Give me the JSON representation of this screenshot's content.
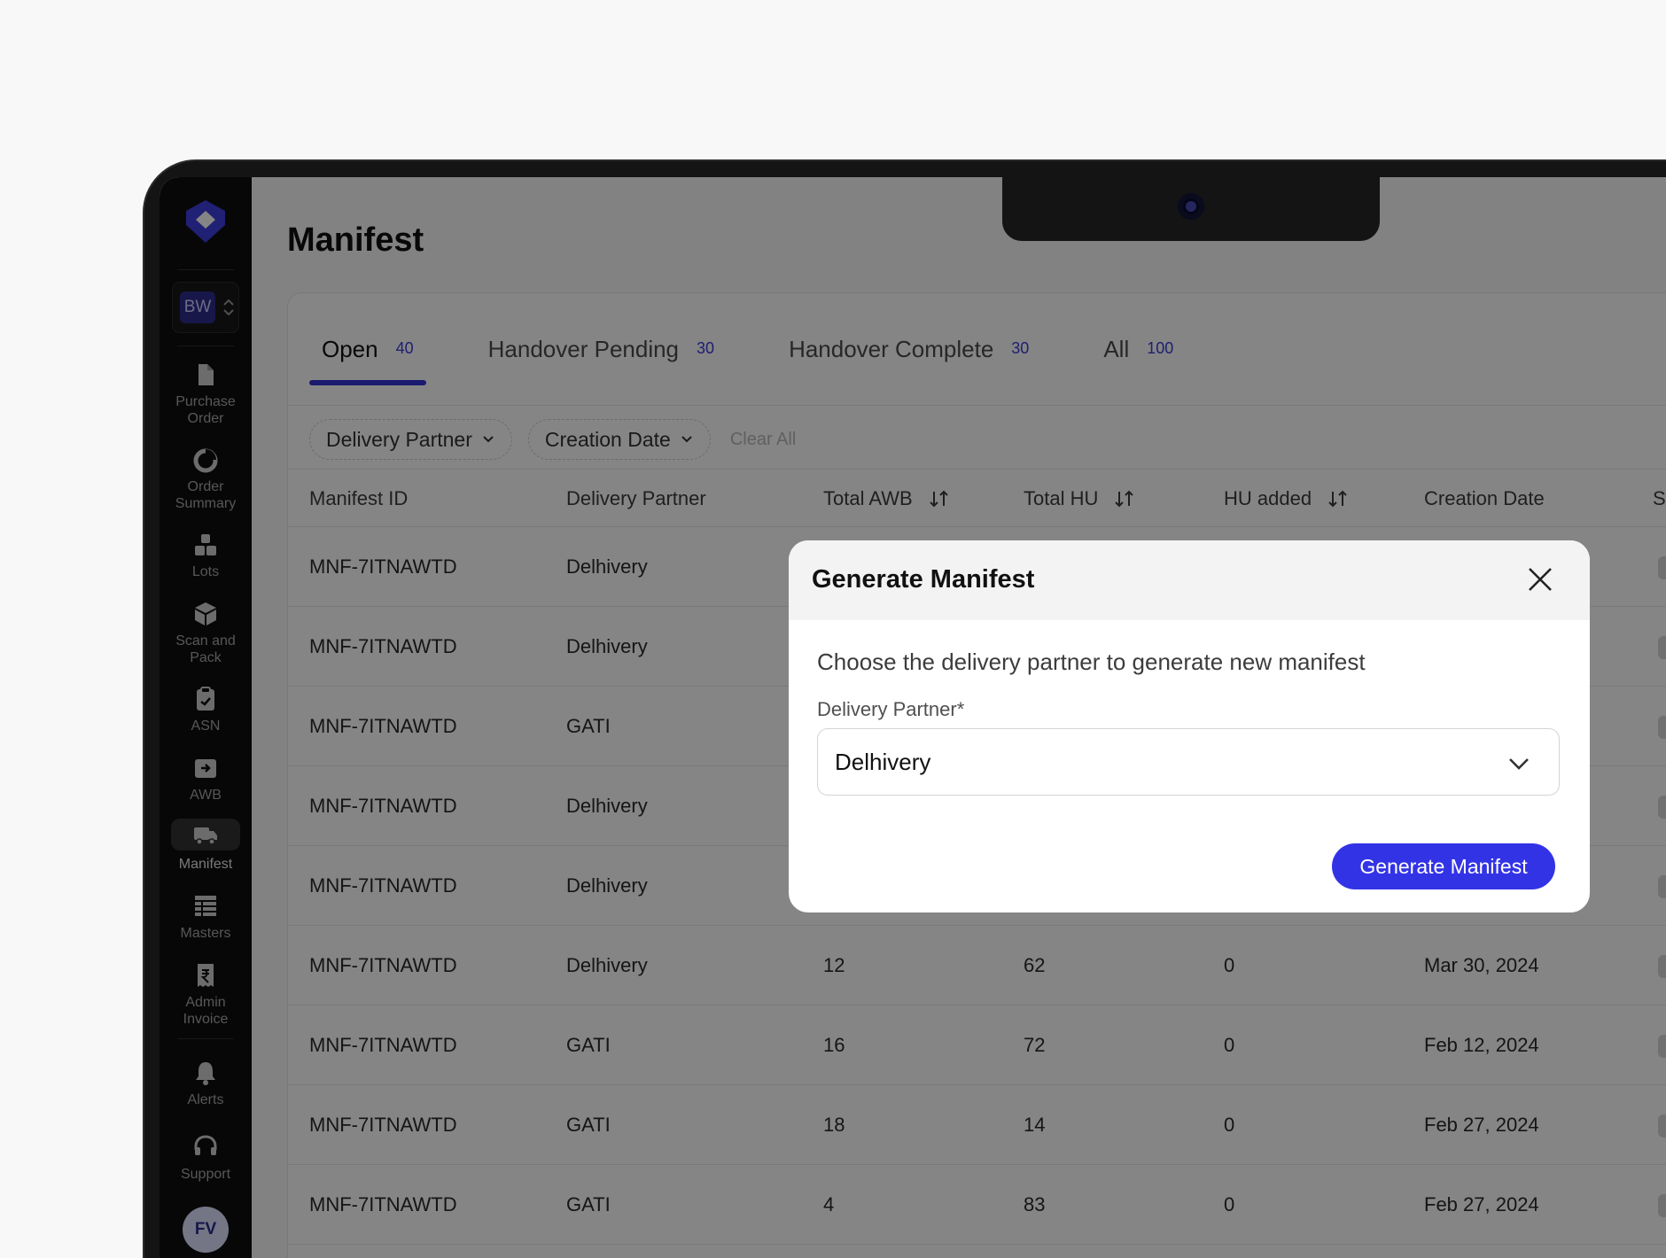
{
  "sidebar": {
    "workspace_initials": "BW",
    "items": [
      {
        "label": "Purchase Order",
        "icon": "document-icon"
      },
      {
        "label": "Order Summary",
        "icon": "pie-chart-icon"
      },
      {
        "label": "Lots",
        "icon": "boxes-icon"
      },
      {
        "label": "Scan and Pack",
        "icon": "package-icon"
      },
      {
        "label": "ASN",
        "icon": "clipboard-icon"
      },
      {
        "label": "AWB",
        "icon": "inbox-arrow-icon"
      },
      {
        "label": "Manifest",
        "icon": "truck-icon",
        "active": true
      },
      {
        "label": "Masters",
        "icon": "table-icon"
      },
      {
        "label": "Admin Invoice",
        "icon": "rupee-invoice-icon"
      },
      {
        "label": "Alerts",
        "icon": "bell-icon"
      },
      {
        "label": "Support",
        "icon": "headset-icon"
      }
    ],
    "user_initials": "FV"
  },
  "page": {
    "title": "Manifest"
  },
  "tabs": [
    {
      "label": "Open",
      "count": "40",
      "active": true
    },
    {
      "label": "Handover Pending",
      "count": "30"
    },
    {
      "label": "Handover Complete",
      "count": "30"
    },
    {
      "label": "All",
      "count": "100"
    }
  ],
  "filters": {
    "delivery_partner": "Delivery Partner",
    "creation_date": "Creation Date",
    "clear_all": "Clear All"
  },
  "table": {
    "columns": [
      "Manifest ID",
      "Delivery Partner",
      "Total AWB",
      "Total HU",
      "HU added",
      "Creation Date",
      "S"
    ],
    "rows": [
      [
        "MNF-7ITNAWTD",
        "Delhivery",
        "",
        "",
        "",
        ""
      ],
      [
        "MNF-7ITNAWTD",
        "Delhivery",
        "",
        "",
        "",
        ""
      ],
      [
        "MNF-7ITNAWTD",
        "GATI",
        "",
        "",
        "",
        ""
      ],
      [
        "MNF-7ITNAWTD",
        "Delhivery",
        "",
        "",
        "",
        ""
      ],
      [
        "MNF-7ITNAWTD",
        "Delhivery",
        "",
        "",
        "",
        ""
      ],
      [
        "MNF-7ITNAWTD",
        "Delhivery",
        "12",
        "62",
        "0",
        "Mar 30, 2024"
      ],
      [
        "MNF-7ITNAWTD",
        "GATI",
        "16",
        "72",
        "0",
        "Feb 12, 2024"
      ],
      [
        "MNF-7ITNAWTD",
        "GATI",
        "18",
        "14",
        "0",
        "Feb 27, 2024"
      ],
      [
        "MNF-7ITNAWTD",
        "GATI",
        "4",
        "83",
        "0",
        "Feb 27, 2024"
      ]
    ]
  },
  "modal": {
    "title": "Generate Manifest",
    "description": "Choose the delivery partner to generate new manifest",
    "field_label": "Delivery Partner*",
    "selected_partner": "Delhivery",
    "submit_label": "Generate Manifest"
  },
  "colors": {
    "accent": "#3333e6",
    "sidebar_bg": "#0f0f0f",
    "tab_count": "#3b3bd8"
  }
}
